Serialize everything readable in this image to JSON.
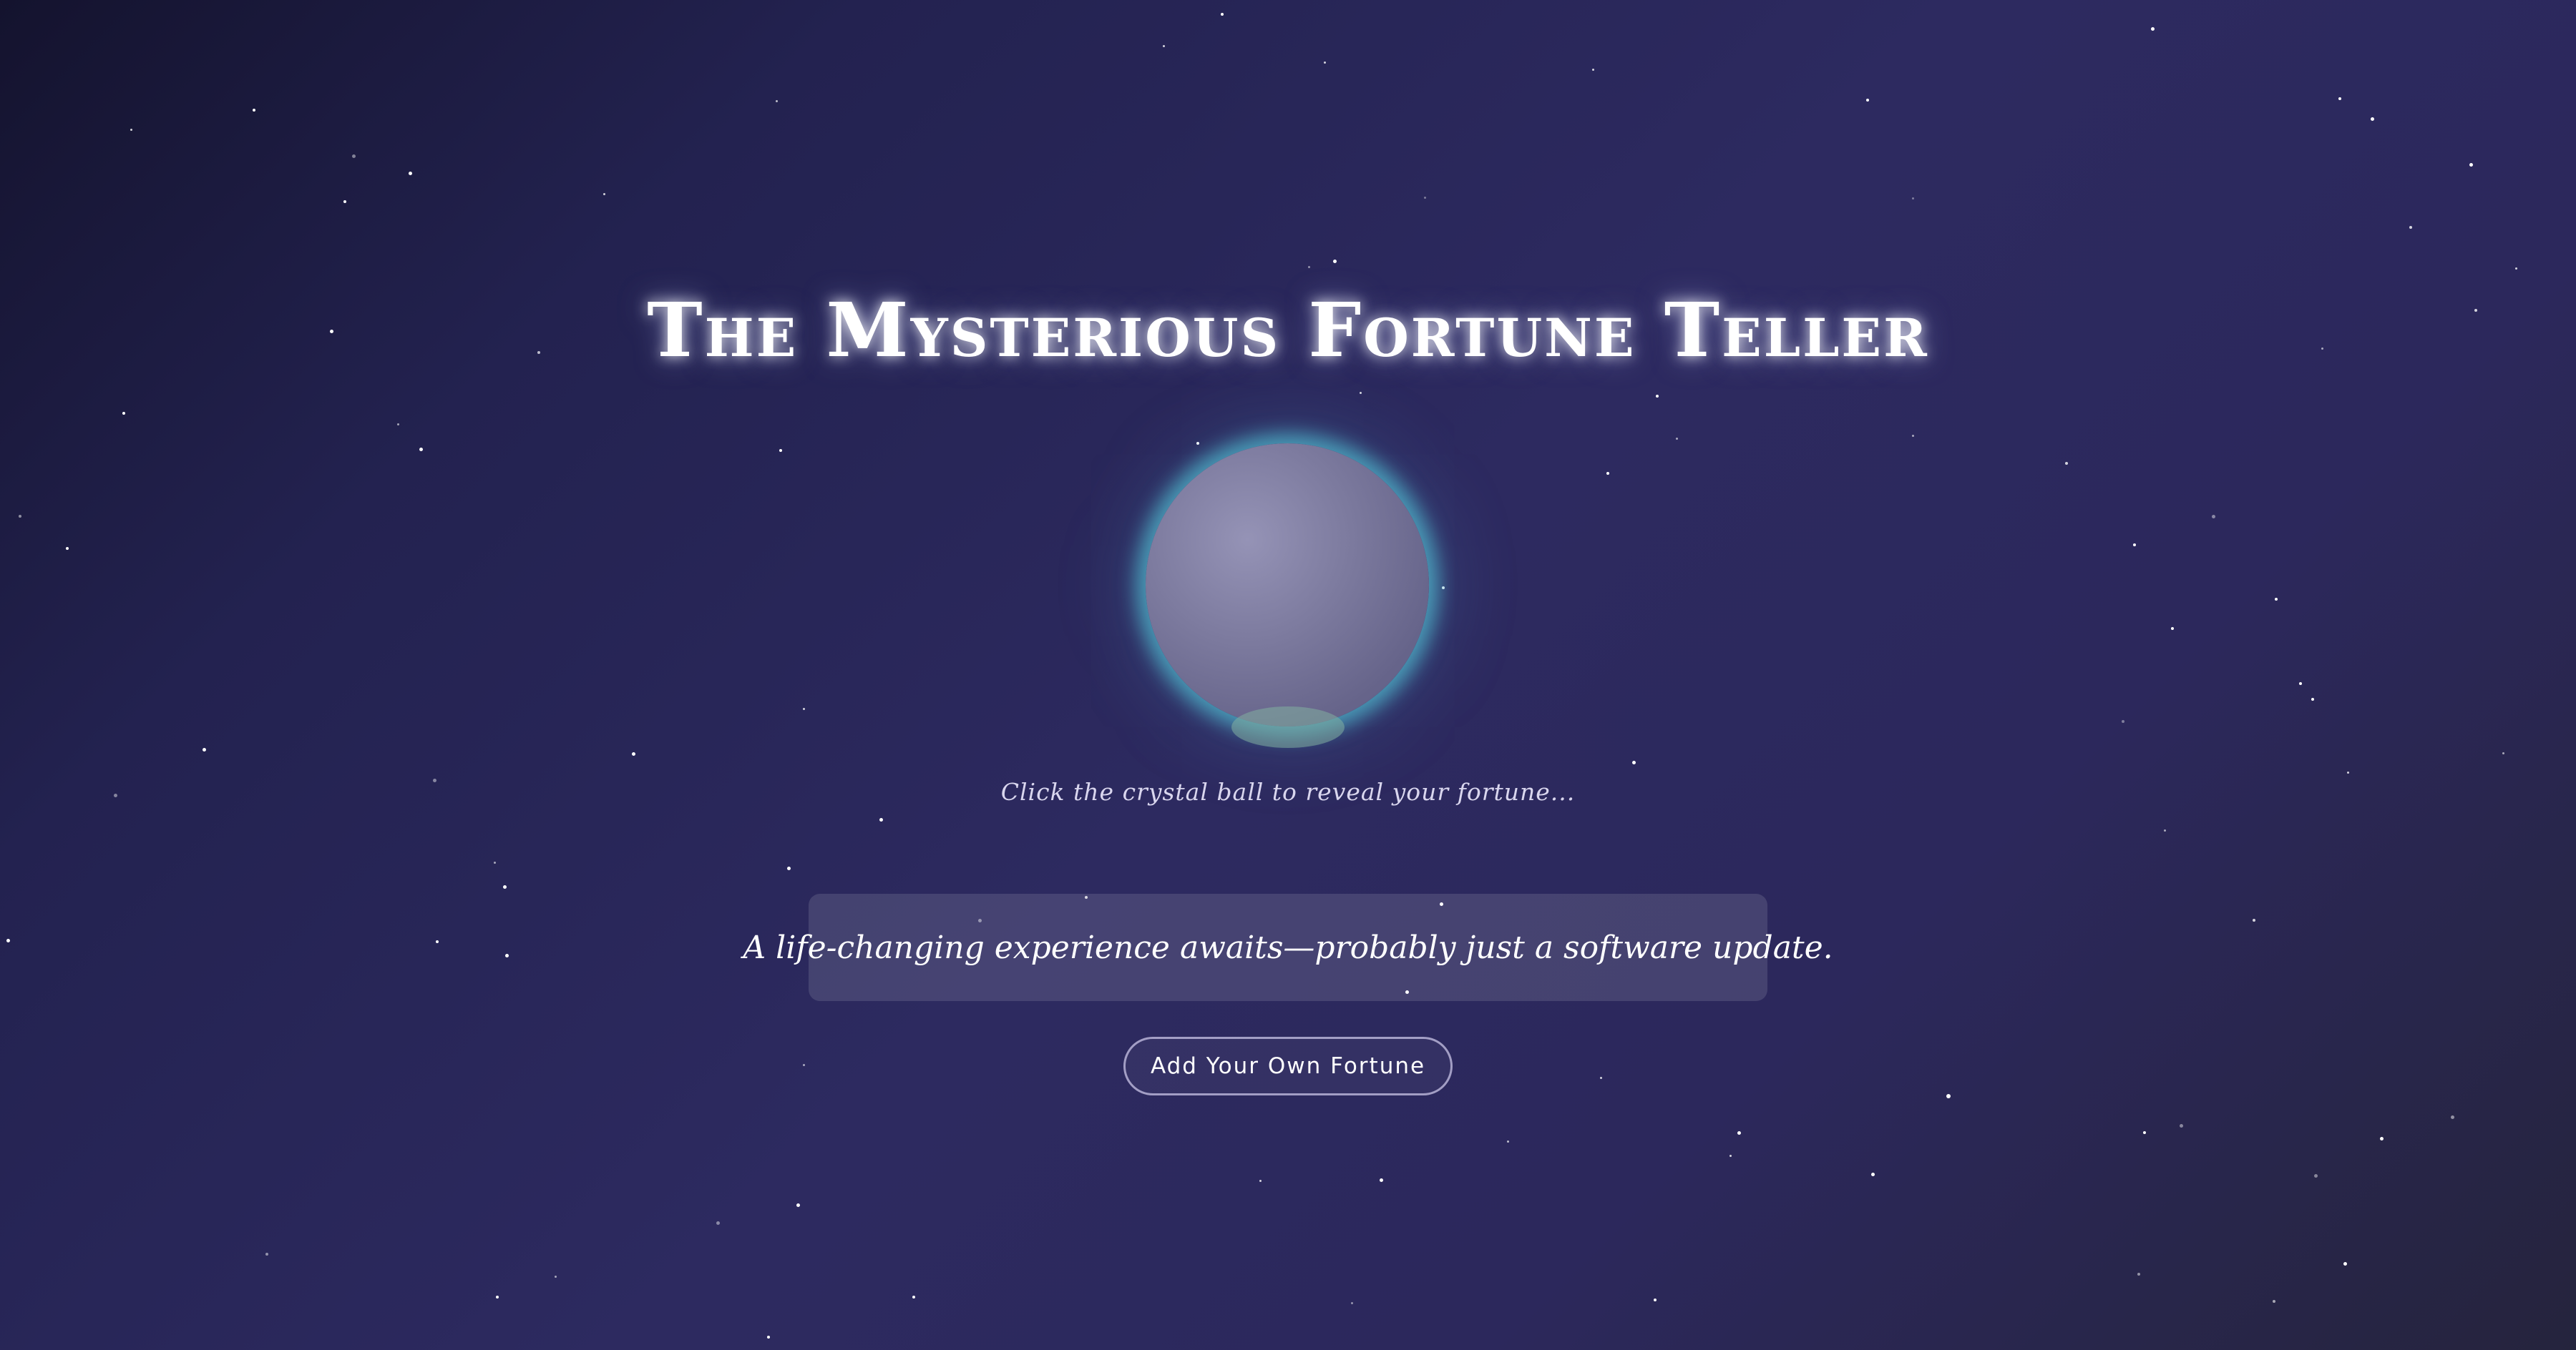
{
  "page": {
    "title": "The Mysterious Fortune Teller"
  },
  "crystal_ball": {
    "hint": "Click the crystal ball to reveal your fortune..."
  },
  "fortune": {
    "text": "A life-changing experience awaits—probably just a software update."
  },
  "actions": {
    "add_fortune_label": "Add Your Own Fortune"
  },
  "colors": {
    "background_dark": "#14132e",
    "background_mid": "#2d2a60",
    "ball_glow": "#50b9cd",
    "ball_fill": "#7c7a9e",
    "text": "#ffffff"
  }
}
